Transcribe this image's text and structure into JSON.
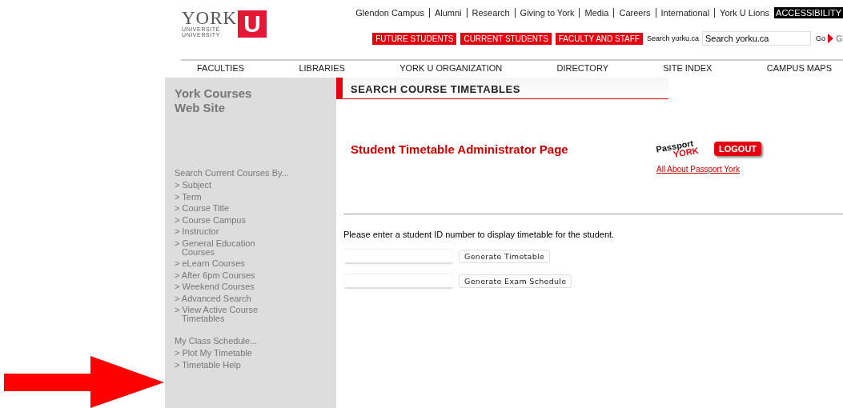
{
  "logo": {
    "wordmark": "YORK",
    "line_1": "UNIVERSITÉ",
    "line_2": "UNIVERSITY",
    "letter": "U"
  },
  "top_links": [
    "Glendon Campus",
    "Alumni",
    "Research",
    "Giving to York",
    "Media",
    "Careers",
    "International",
    "York U Lions"
  ],
  "accessibility": "ACCESSIBILITY",
  "audience_buttons": [
    "FUTURE STUDENTS",
    "CURRENT STUDENTS",
    "FACULTY AND STAFF"
  ],
  "search": {
    "label": "Search yorku.ca",
    "value": "Search yorku.ca",
    "go": "Go",
    "go_graphic": "G"
  },
  "nav": [
    "FACULTIES",
    "LIBRARIES",
    "YORK U ORGANIZATION",
    "DIRECTORY",
    "SITE INDEX",
    "CAMPUS MAPS"
  ],
  "sidebar": {
    "title": "York Courses Web Site",
    "groups": [
      {
        "heading": "Search Current Courses By...",
        "items": [
          "> Subject",
          "> Term",
          "> Course Title",
          "> Course Campus",
          "> Instructor",
          "> General Education Courses",
          "> eLearn Courses",
          "> After 6pm Courses",
          "> Weekend Courses",
          "> Advanced Search",
          "> View Active Course Timetables"
        ]
      },
      {
        "heading": "My Class Schedule...",
        "items": [
          "> Plot My Timetable",
          "> Timetable Help"
        ]
      }
    ]
  },
  "section_title": "SEARCH COURSE TIMETABLES",
  "page_title": "Student Timetable Administrator Page",
  "passport": {
    "word_1": "Passport",
    "word_2": "YORK",
    "logout": "LOGOUT",
    "link": "All About Passport York"
  },
  "instruction": "Please enter a student ID number to display timetable for the student.",
  "forms": [
    {
      "button": "Generate Timetable"
    },
    {
      "button": "Generate Exam Schedule"
    }
  ]
}
